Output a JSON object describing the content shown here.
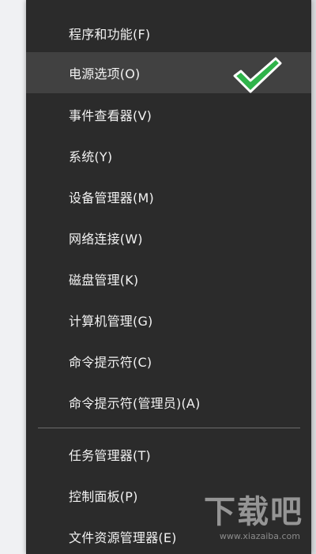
{
  "menu": {
    "items": [
      {
        "label": "程序和功能(F)"
      },
      {
        "label": "电源选项(O)"
      },
      {
        "label": "事件查看器(V)"
      },
      {
        "label": "系统(Y)"
      },
      {
        "label": "设备管理器(M)"
      },
      {
        "label": "网络连接(W)"
      },
      {
        "label": "磁盘管理(K)"
      },
      {
        "label": "计算机管理(G)"
      },
      {
        "label": "命令提示符(C)"
      },
      {
        "label": "命令提示符(管理员)(A)"
      },
      {
        "label": "任务管理器(T)"
      },
      {
        "label": "控制面板(P)"
      },
      {
        "label": "文件资源管理器(E)"
      }
    ],
    "highlighted_index": 1
  },
  "annotation": {
    "icon": "checkmark-icon",
    "color": "#2fb34a"
  },
  "watermark": {
    "logo_text": "下载吧",
    "url_text": "www.xiazaiba.com"
  },
  "colors": {
    "menu_bg": "#2b2b2b",
    "highlight_bg": "#414141",
    "text": "#f2f2f2",
    "separator": "#6b6b6b"
  }
}
